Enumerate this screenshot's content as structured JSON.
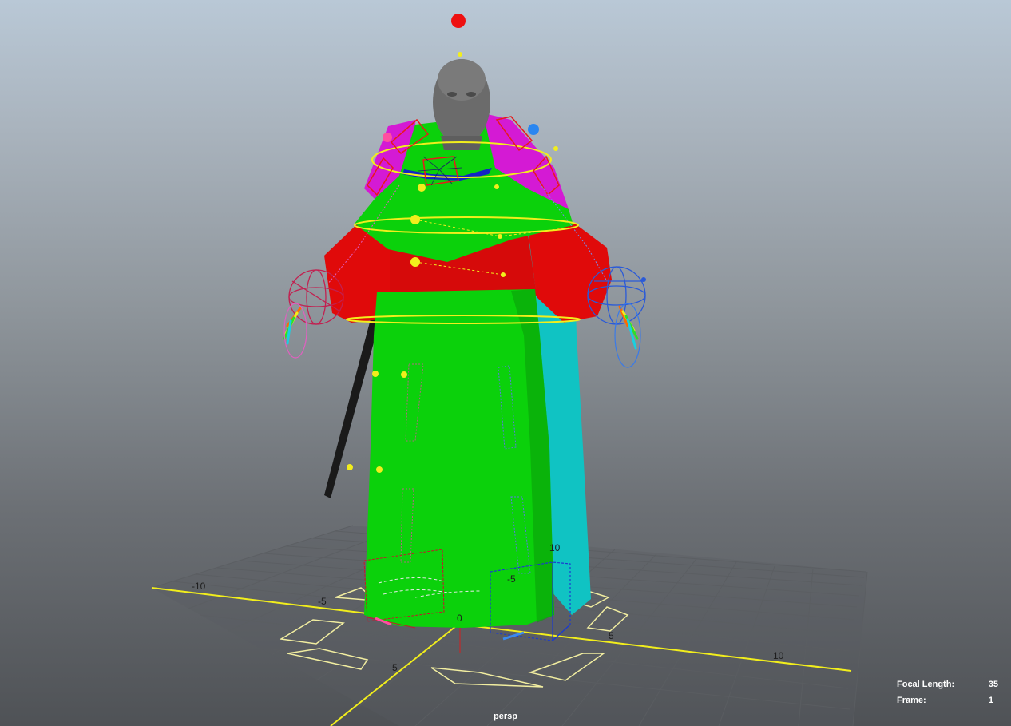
{
  "viewport": {
    "camera_name": "persp",
    "hud": {
      "focal_length_label": "Focal Length:",
      "focal_length_value": "35",
      "frame_label": "Frame:",
      "frame_value": "1"
    },
    "grid_labels": {
      "neg10": "-10",
      "neg5_left": "-5",
      "zero": "0",
      "pos5_bottom": "5",
      "pos5_right": "5",
      "pos10": "10",
      "neg5_back": "-5",
      "back10": "10"
    }
  },
  "colors": {
    "robe": "#0bd10b",
    "sleeves": "#e00a0a",
    "shoulders": "#d41ad4",
    "cape": "#10c3c3",
    "head": "#6b6b6b",
    "axis_x": "#f2ee1c",
    "controls": "#f2ee1c",
    "left_side_ctrl": "#d02050",
    "right_side_ctrl": "#2a5ad8"
  }
}
